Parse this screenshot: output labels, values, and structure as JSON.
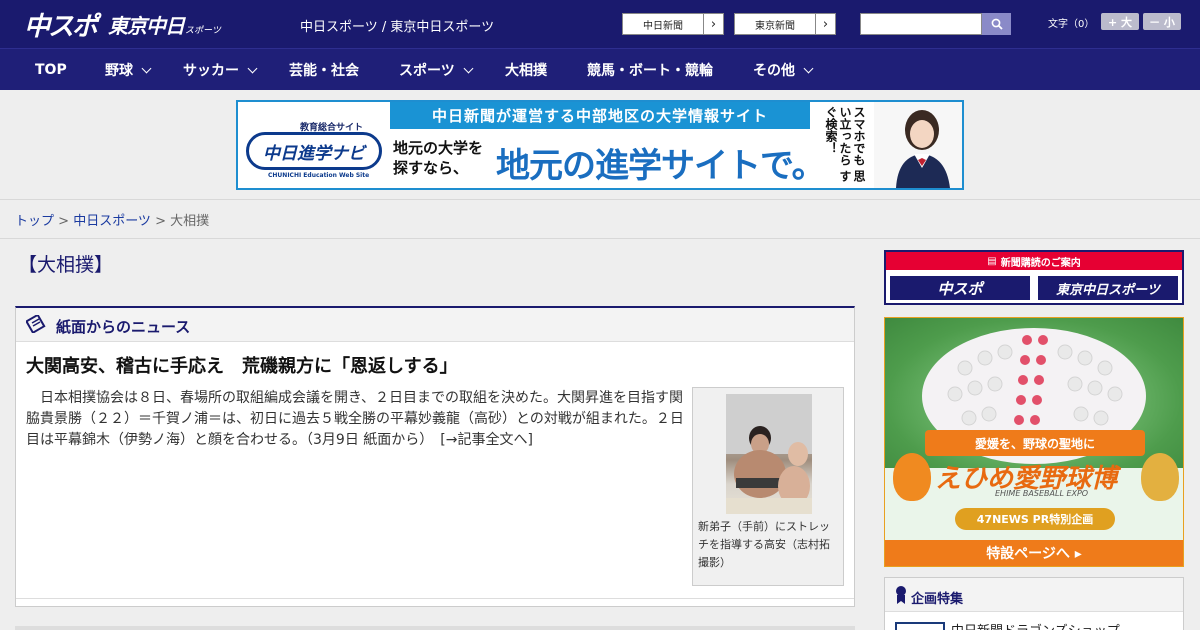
{
  "header": {
    "logo_chuspo": "中スポ",
    "logo_tokyo": "東京中日",
    "logo_tokyo_small": "スポーツ",
    "site_title": "中日スポーツ / 東京中日スポーツ",
    "paper_links": [
      {
        "label": "中日新聞",
        "arrow": "›"
      },
      {
        "label": "東京新聞",
        "arrow": "›"
      }
    ],
    "search_placeholder": "",
    "font_label": "文字（0）",
    "font_larger": "+ 大",
    "font_smaller": "－ 小"
  },
  "nav": {
    "items": [
      {
        "label": "TOP"
      },
      {
        "label": "野球"
      },
      {
        "label": "サッカー"
      },
      {
        "label": "芸能・社会"
      },
      {
        "label": "スポーツ"
      },
      {
        "label": "大相撲"
      },
      {
        "label": "競馬・ボート・競輪"
      },
      {
        "label": "その他"
      }
    ]
  },
  "banner": {
    "edu_small": "教育総合サイト",
    "logo": "中日進学ナビ",
    "logo_sub": "CHUNICHI Education Web Site",
    "topline": "中日新聞が運営する中部地区の大学情報サイト",
    "sub_left_1": "地元の大学を",
    "sub_left_2": "探すなら、",
    "big": "地元の進学サイトで。",
    "vertical": "スマホでも 思い立ったら すぐ検索！"
  },
  "breadcrumb": {
    "top": "トップ",
    "sep1": " > ",
    "chunichi": "中日スポーツ",
    "sep2": " > ",
    "current": "大相撲"
  },
  "main": {
    "heading": "【大相撲】",
    "news_box_title": "紙面からのニュース",
    "article": {
      "title": "大関高安、稽古に手応え　荒磯親方に「恩返しする」",
      "body": "日本相撲協会は８日、春場所の取組編成会議を開き、２日目までの取組を決めた。大関昇進を目指す関脇貴景勝（２２）＝千賀ノ浦＝は、初日に過去５戦全勝の平幕妙義龍（高砂）との対戦が組まれた。２日目は平幕錦木（伊勢ノ海）と顔を合わせる。（3月9日 紙面から）　[→記事全文へ]",
      "caption": "新弟子（手前）にストレッチを指導する高安（志村拓撮影）"
    }
  },
  "sidebar": {
    "subscription_head": "新聞購読のご案内",
    "sub_chuspo": "中スポ",
    "sub_tokyo": "東京中日スポーツ",
    "ehime": {
      "ribbon": "愛媛を、野球の聖地に",
      "title": "えひめ愛野球博",
      "expo": "EHIME BASEBALL EXPO",
      "pr": "47NEWS PR特別企画",
      "special": "特設ページへ ▸"
    },
    "feature_title": "企画特集",
    "feature_item": "中日新聞ドラゴンズショップ"
  }
}
